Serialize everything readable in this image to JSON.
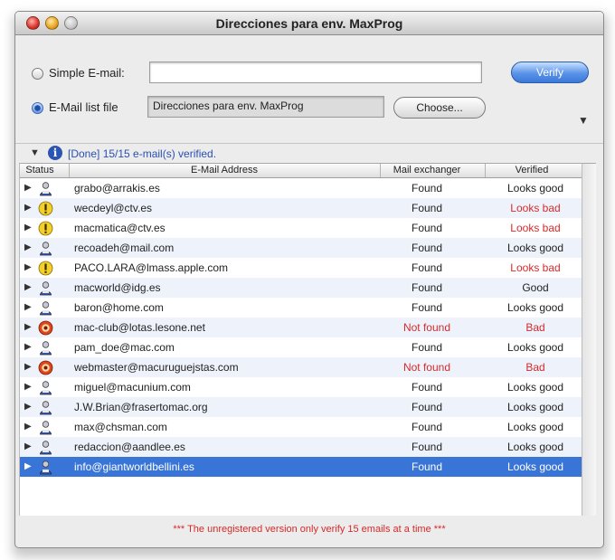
{
  "window": {
    "title": "Direcciones para env. MaxProg"
  },
  "form": {
    "simple_label": "Simple E-mail:",
    "simple_value": "",
    "file_label": "E-Mail list file",
    "file_value": "Direcciones para env. MaxProg",
    "verify_label": "Verify",
    "choose_label": "Choose..."
  },
  "status": {
    "text": "[Done] 15/15 e-mail(s) verified."
  },
  "table": {
    "columns": [
      "Status",
      "E-Mail Address",
      "Mail exchanger",
      "Verified"
    ],
    "rows": [
      {
        "icon": "person-icon",
        "email": "grabo@arrakis.es",
        "found": "Found",
        "verified": "Looks good"
      },
      {
        "icon": "warning-icon",
        "email": "wecdeyl@ctv.es",
        "found": "Found",
        "verified": "Looks bad"
      },
      {
        "icon": "warning-icon",
        "email": "macmatica@ctv.es",
        "found": "Found",
        "verified": "Looks bad"
      },
      {
        "icon": "person-icon",
        "email": "recoadeh@mail.com",
        "found": "Found",
        "verified": "Looks good"
      },
      {
        "icon": "warning-icon",
        "email": "PACO.LARA@lmass.apple.com",
        "found": "Found",
        "verified": "Looks bad"
      },
      {
        "icon": "person-icon",
        "email": "macworld@idg.es",
        "found": "Found",
        "verified": "Good"
      },
      {
        "icon": "person-icon",
        "email": "baron@home.com",
        "found": "Found",
        "verified": "Looks good"
      },
      {
        "icon": "stop-icon",
        "email": "mac-club@lotas.lesone.net",
        "found": "Not found",
        "verified": "Bad"
      },
      {
        "icon": "person-icon",
        "email": "pam_doe@mac.com",
        "found": "Found",
        "verified": "Looks good"
      },
      {
        "icon": "stop-icon",
        "email": "webmaster@macuruguejstas.com",
        "found": "Not found",
        "verified": "Bad"
      },
      {
        "icon": "person-icon",
        "email": "miguel@macunium.com",
        "found": "Found",
        "verified": "Looks good"
      },
      {
        "icon": "person-icon",
        "email": "J.W.Brian@frasertomac.org",
        "found": "Found",
        "verified": "Looks good"
      },
      {
        "icon": "person-icon",
        "email": "max@chsman.com",
        "found": "Found",
        "verified": "Looks good"
      },
      {
        "icon": "person-icon",
        "email": "redaccion@aandlee.es",
        "found": "Found",
        "verified": "Looks good"
      },
      {
        "icon": "person-icon",
        "email": "info@giantworldbellini.es",
        "found": "Found",
        "verified": "Looks good",
        "selected": true
      }
    ]
  },
  "footer": {
    "text": "*** The unregistered version only verify 15 emails at a time ***"
  },
  "colors": {
    "selection": "#3875d7",
    "alert_red": "#d62a2a",
    "status_blue": "#2b4fb3"
  }
}
